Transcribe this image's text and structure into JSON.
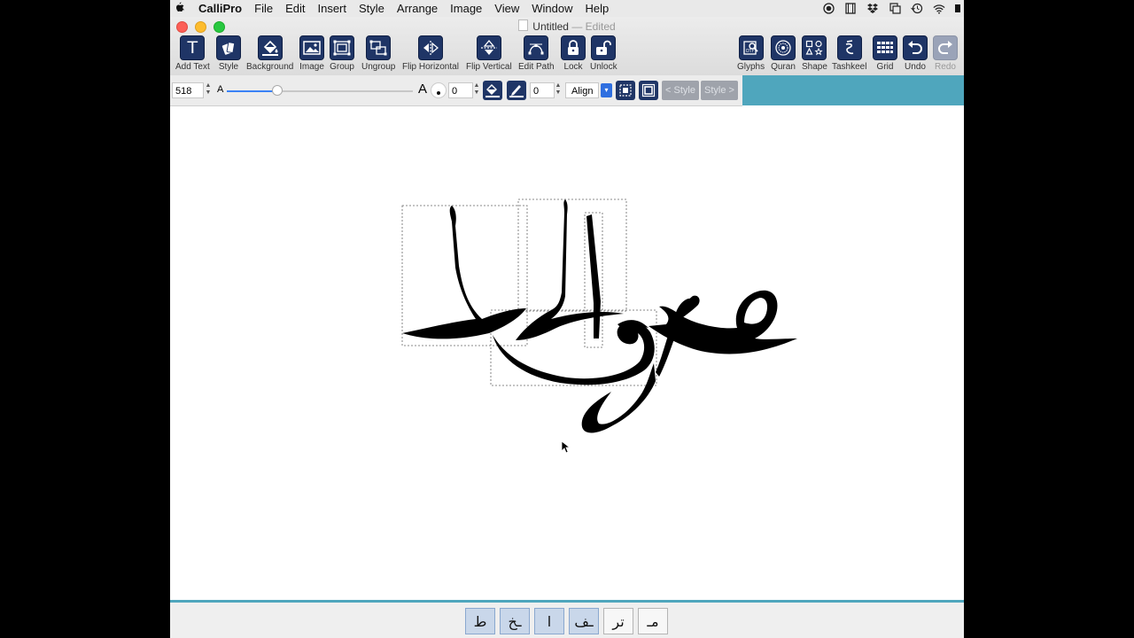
{
  "menubar": {
    "app_name": "CalliPro",
    "items": [
      "File",
      "Edit",
      "Insert",
      "Style",
      "Arrange",
      "Image",
      "View",
      "Window",
      "Help"
    ]
  },
  "window": {
    "title": "Untitled",
    "title_suffix": "— Edited"
  },
  "toolbar": {
    "add_text": "Add Text",
    "style": "Style",
    "background": "Background",
    "image": "Image",
    "group": "Group",
    "ungroup": "Ungroup",
    "flip_horizontal": "Flip Horizontal",
    "flip_vertical": "Flip Vertical",
    "edit_path": "Edit Path",
    "lock": "Lock",
    "unlock": "Unlock",
    "glyphs": "Glyphs",
    "quran": "Quran",
    "shape": "Shape",
    "tashkeel": "Tashkeel",
    "grid": "Grid",
    "undo": "Undo",
    "redo": "Redo"
  },
  "format_bar": {
    "font_size": "518",
    "small_a": "A",
    "large_a": "A",
    "stroke_value": "0",
    "outline_value": "0",
    "align_label": "Align",
    "prev_style": "< Style",
    "next_style": "Style >",
    "font_size_slider_fraction": 0.27
  },
  "glyph_strip": [
    "ط",
    "ـخ",
    "ا",
    "ـف",
    "تر",
    "مـ"
  ],
  "colors": {
    "accent_teal": "#4fa6bd",
    "toolbar_icon_bg": "#1f3566"
  }
}
